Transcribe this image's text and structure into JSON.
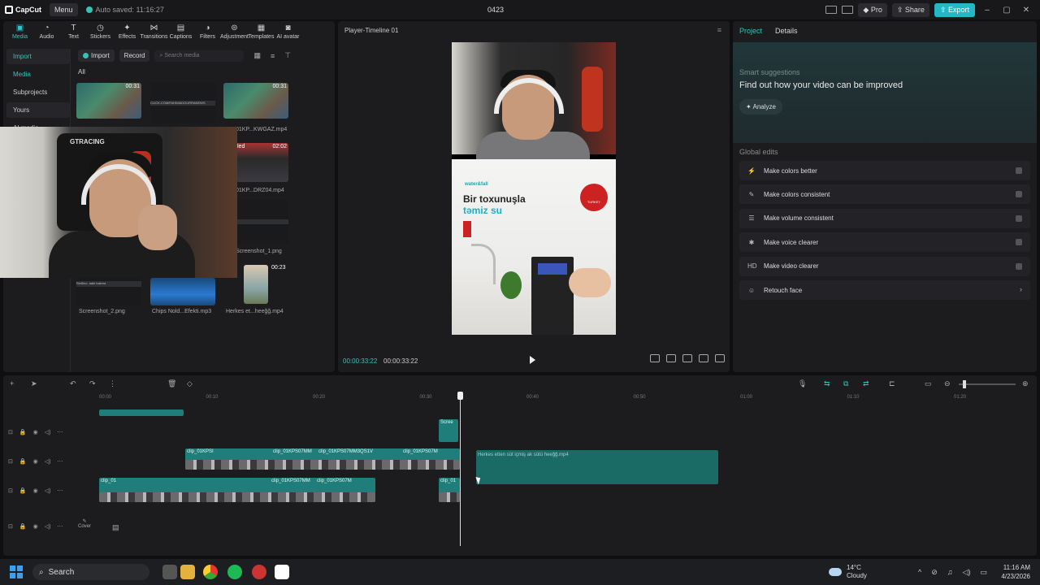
{
  "app": {
    "logo_text": "CapCut",
    "menu_label": "Menu",
    "autosave": "Auto saved: 11:16:27",
    "project_title": "0423",
    "pro_label": "Pro",
    "share_label": "Share",
    "export_label": "Export"
  },
  "media_tools": [
    {
      "label": "Media",
      "icon": "media-icon"
    },
    {
      "label": "Audio",
      "icon": "audio-icon"
    },
    {
      "label": "Text",
      "icon": "text-icon"
    },
    {
      "label": "Stickers",
      "icon": "stickers-icon"
    },
    {
      "label": "Effects",
      "icon": "effects-icon"
    },
    {
      "label": "Transitions",
      "icon": "transitions-icon"
    },
    {
      "label": "Captions",
      "icon": "captions-icon"
    },
    {
      "label": "Filters",
      "icon": "filters-icon"
    },
    {
      "label": "Adjustment",
      "icon": "adjustment-icon"
    },
    {
      "label": "Templates",
      "icon": "templates-icon"
    },
    {
      "label": "AI avatar",
      "icon": "ai-avatar-icon"
    }
  ],
  "side_nav": {
    "import": "Import",
    "media": "Media",
    "subprojects": "Subprojects",
    "yours": "Yours",
    "ai_media": "AI media"
  },
  "media_toolbar": {
    "import_btn": "Import",
    "record_btn": "Record",
    "search_placeholder": "Search media",
    "all_label": "All"
  },
  "media_items": [
    {
      "caption": "",
      "duration": "00:31"
    },
    {
      "caption": "",
      "duration": "",
      "banner": "CLICK.COM/FAHIMADOURRANEWS"
    },
    {
      "caption": "01KP...KWGAZ.mp4",
      "duration": "00:31"
    },
    {
      "caption": "01KP...DRZ04.mp4",
      "duration": "02:02",
      "tag": "led"
    },
    {
      "caption": "Screenshot_1.png",
      "duration": ""
    },
    {
      "caption": "Screenshot_2.png",
      "duration": "",
      "banner": "Redlinc: aabi bakma"
    },
    {
      "caption": "Chips Nold...Efekti.mp3",
      "duration": ""
    },
    {
      "caption": "Herkes et...heeğğ.mp4",
      "duration": "00:23"
    }
  ],
  "player": {
    "title": "Player-Timeline 01",
    "time_current": "00:00:33:22",
    "time_total": "00:00:33:22",
    "ad_brand": "water&fall",
    "ad_headline": "Bir toxunuşla",
    "ad_subhead": "təmiz su",
    "ad_badge": "TURKEY"
  },
  "props": {
    "tab_project": "Project",
    "tab_details": "Details",
    "smart_title": "Smart suggestions",
    "smart_desc": "Find out how your video can be improved",
    "analyze": "Analyze",
    "global_title": "Global edits",
    "edits": [
      {
        "label": "Make colors better",
        "icon": "wand-icon",
        "kind": "toggle"
      },
      {
        "label": "Make colors consistent",
        "icon": "brush-icon",
        "kind": "toggle"
      },
      {
        "label": "Make volume consistent",
        "icon": "sliders-icon",
        "kind": "toggle"
      },
      {
        "label": "Make voice clearer",
        "icon": "voice-icon",
        "kind": "toggle"
      },
      {
        "label": "Make video clearer",
        "icon": "hd-icon",
        "kind": "toggle",
        "icon_text": "HD"
      },
      {
        "label": "Retouch face",
        "icon": "face-icon",
        "kind": "chevron"
      }
    ]
  },
  "timeline": {
    "ticks": [
      "00:00",
      "00:10",
      "00:20",
      "00:30",
      "00:40",
      "00:50",
      "01:00",
      "01:10",
      "01:20"
    ],
    "clip_label_1": "clip_01KPSI",
    "clip_label_2": "clip_01KPS07MM",
    "clip_label_3": "clip_01KPS07MM3QS1V",
    "clip_label_4": "clip_01KPS07M",
    "clip_label_short": "clip_01",
    "clip_screen": "Scree",
    "clip_floating": "Herkes etten süt içmiş ak sütü heeğğ.mp4",
    "cover": "Cover"
  },
  "taskbar": {
    "search": "Search",
    "temp": "14°C",
    "weather": "Cloudy",
    "time": "11:16 AM",
    "date": "4/23/2026"
  }
}
